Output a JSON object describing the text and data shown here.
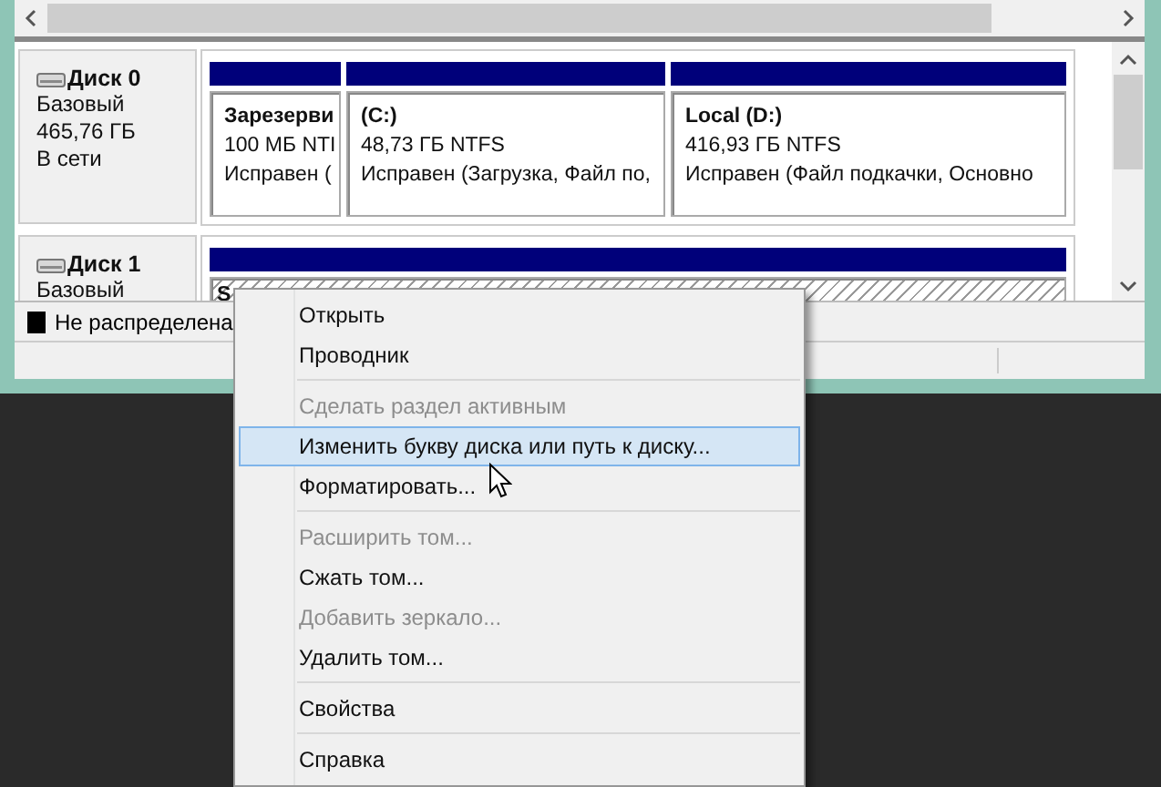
{
  "disks": [
    {
      "name": "Диск 0",
      "type": "Базовый",
      "size": "465,76 ГБ",
      "status": "В сети",
      "partitions": [
        {
          "label": "Зарезерви",
          "size": "100 МБ NTI",
          "health": "Исправен (",
          "kind": "primary",
          "selected": false
        },
        {
          "label": "(C:)",
          "size": "48,73 ГБ NTFS",
          "health": "Исправен (Загрузка, Файл по,",
          "kind": "primary",
          "selected": false
        },
        {
          "label": "Local  (D:)",
          "size": "416,93 ГБ NTFS",
          "health": "Исправен (Файл подкачки, Основно",
          "kind": "primary",
          "selected": false
        }
      ]
    },
    {
      "name": "Диск 1",
      "type": "Базовый",
      "partitions": [
        {
          "label": "S",
          "kind": "primary",
          "selected": true
        }
      ]
    }
  ],
  "legend": [
    {
      "label": "Не распределена",
      "color": "#000000"
    }
  ],
  "context_menu": [
    {
      "kind": "item",
      "label": "Открыть",
      "disabled": false,
      "selected": false
    },
    {
      "kind": "item",
      "label": "Проводник",
      "disabled": false,
      "selected": false
    },
    {
      "kind": "separator"
    },
    {
      "kind": "item",
      "label": "Сделать раздел активным",
      "disabled": true,
      "selected": false
    },
    {
      "kind": "item",
      "label": "Изменить букву диска или путь к диску...",
      "disabled": false,
      "selected": true
    },
    {
      "kind": "item",
      "label": "Форматировать...",
      "disabled": false,
      "selected": false
    },
    {
      "kind": "separator"
    },
    {
      "kind": "item",
      "label": "Расширить том...",
      "disabled": true,
      "selected": false
    },
    {
      "kind": "item",
      "label": "Сжать том...",
      "disabled": false,
      "selected": false
    },
    {
      "kind": "item",
      "label": "Добавить зеркало...",
      "disabled": true,
      "selected": false
    },
    {
      "kind": "item",
      "label": "Удалить том...",
      "disabled": false,
      "selected": false
    },
    {
      "kind": "separator"
    },
    {
      "kind": "item",
      "label": "Свойства",
      "disabled": false,
      "selected": false
    },
    {
      "kind": "separator"
    },
    {
      "kind": "item",
      "label": "Справка",
      "disabled": false,
      "selected": false
    }
  ]
}
